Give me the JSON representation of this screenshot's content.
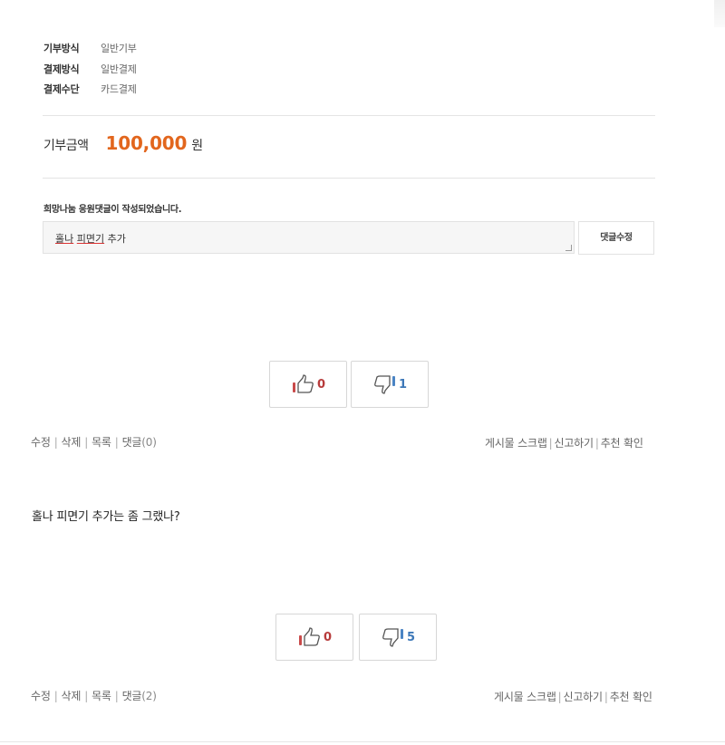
{
  "donation_info": [
    {
      "label": "기부방식",
      "value": "일반기부"
    },
    {
      "label": "결제방식",
      "value": "일반결제"
    },
    {
      "label": "결제수단",
      "value": "카드결제"
    }
  ],
  "amount": {
    "label": "기부금액",
    "value": "100,000",
    "unit": "원"
  },
  "comment": {
    "notice": "희망나눔 응원댓글이 작성되었습니다.",
    "text_part1": "홀나",
    "text_part2": "피면기",
    "text_part3": "추가",
    "edit_label": "댓글수정"
  },
  "post1": {
    "votes": {
      "up": "0",
      "down": "1"
    },
    "actions_left": {
      "edit": "수정",
      "delete": "삭제",
      "list": "목록",
      "comment": "댓글",
      "comment_count": "(0)"
    },
    "actions_right": {
      "scrap": "게시물 스크랩",
      "report": "신고하기",
      "recommend": "추천 확인"
    }
  },
  "post2": {
    "text": "홀나 피면기 추가는 좀 그랬나?",
    "votes": {
      "up": "0",
      "down": "5"
    },
    "actions_left": {
      "edit": "수정",
      "delete": "삭제",
      "list": "목록",
      "comment": "댓글",
      "comment_count": "(2)"
    },
    "actions_right": {
      "scrap": "게시물 스크랩",
      "report": "신고하기",
      "recommend": "추천 확인"
    }
  },
  "colors": {
    "accent_orange": "#e2661d",
    "up_red": "#b73b3b",
    "down_blue": "#3d78b8"
  },
  "icons": {
    "up": "thumbs-up-icon",
    "down": "thumbs-down-icon"
  }
}
